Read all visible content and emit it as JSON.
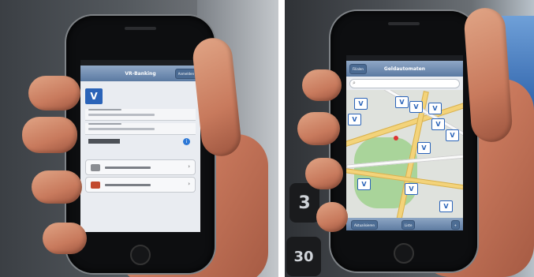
{
  "left_screen": {
    "nav_title": "VR-Banking",
    "nav_button": "Anmelden",
    "logo": "V",
    "info": "i"
  },
  "right_screen": {
    "nav_left": "Filialen",
    "nav_title": "Geldautomaten",
    "toolbar_left": "Aktualisieren",
    "toolbar_mid": "Liste",
    "toolbar_right": "+",
    "pin_label": "V"
  },
  "keyfob": {
    "num1": "3",
    "num2": "30"
  },
  "colors": {
    "vr_blue": "#2a63b8",
    "nav_blue": "#5b7aa2",
    "skin": "#d89a7c"
  }
}
